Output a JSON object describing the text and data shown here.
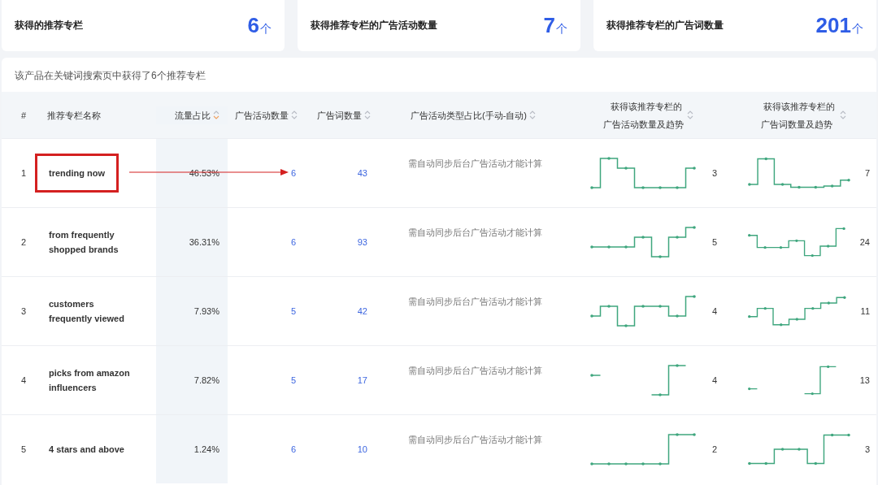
{
  "stats": [
    {
      "label": "获得的推荐专栏",
      "value": "6",
      "unit": "个"
    },
    {
      "label": "获得推荐专栏的广告活动数量",
      "value": "7",
      "unit": "个"
    },
    {
      "label": "获得推荐专栏的广告词数量",
      "value": "201",
      "unit": "个"
    }
  ],
  "table": {
    "caption": "该产品在关键词搜索页中获得了6个推荐专栏",
    "columns": [
      {
        "label": "#",
        "sortable": false
      },
      {
        "label": "推荐专栏名称",
        "sortable": false
      },
      {
        "label": "流量占比",
        "sortable": true,
        "sort_active": true
      },
      {
        "label": "广告活动数量",
        "sortable": true,
        "sort_active": false
      },
      {
        "label": "广告词数量",
        "sortable": true,
        "sort_active": false
      },
      {
        "label": "广告活动类型占比(手动-自动)",
        "sortable": true,
        "sort_active": false
      },
      {
        "label": "获得该推荐专栏的广告活动数量及趋势",
        "sortable": true,
        "sort_active": false
      },
      {
        "label": "获得该推荐专栏的广告词数量及趋势",
        "sortable": true,
        "sort_active": false
      }
    ],
    "rows": [
      {
        "rank": "1",
        "name": "trending now",
        "highlighted": true,
        "traffic_share": "46.53%",
        "campaigns": "6",
        "keywords": "43",
        "type_ratio": "需自动同步后台广告活动才能计算",
        "campaign_trend_count": "3",
        "keyword_trend_count": "7"
      },
      {
        "rank": "2",
        "name": "from frequently shopped brands",
        "highlighted": false,
        "traffic_share": "36.31%",
        "campaigns": "6",
        "keywords": "93",
        "type_ratio": "需自动同步后台广告活动才能计算",
        "campaign_trend_count": "5",
        "keyword_trend_count": "24"
      },
      {
        "rank": "3",
        "name": "customers frequently viewed",
        "highlighted": false,
        "traffic_share": "7.93%",
        "campaigns": "5",
        "keywords": "42",
        "type_ratio": "需自动同步后台广告活动才能计算",
        "campaign_trend_count": "4",
        "keyword_trend_count": "11"
      },
      {
        "rank": "4",
        "name": "picks from amazon influencers",
        "highlighted": false,
        "traffic_share": "7.82%",
        "campaigns": "5",
        "keywords": "17",
        "type_ratio": "需自动同步后台广告活动才能计算",
        "campaign_trend_count": "4",
        "keyword_trend_count": "13"
      },
      {
        "rank": "5",
        "name": "4 stars and above",
        "highlighted": false,
        "traffic_share": "1.24%",
        "campaigns": "6",
        "keywords": "10",
        "type_ratio": "需自动同步后台广告活动才能计算",
        "campaign_trend_count": "2",
        "keyword_trend_count": "3"
      }
    ]
  }
}
